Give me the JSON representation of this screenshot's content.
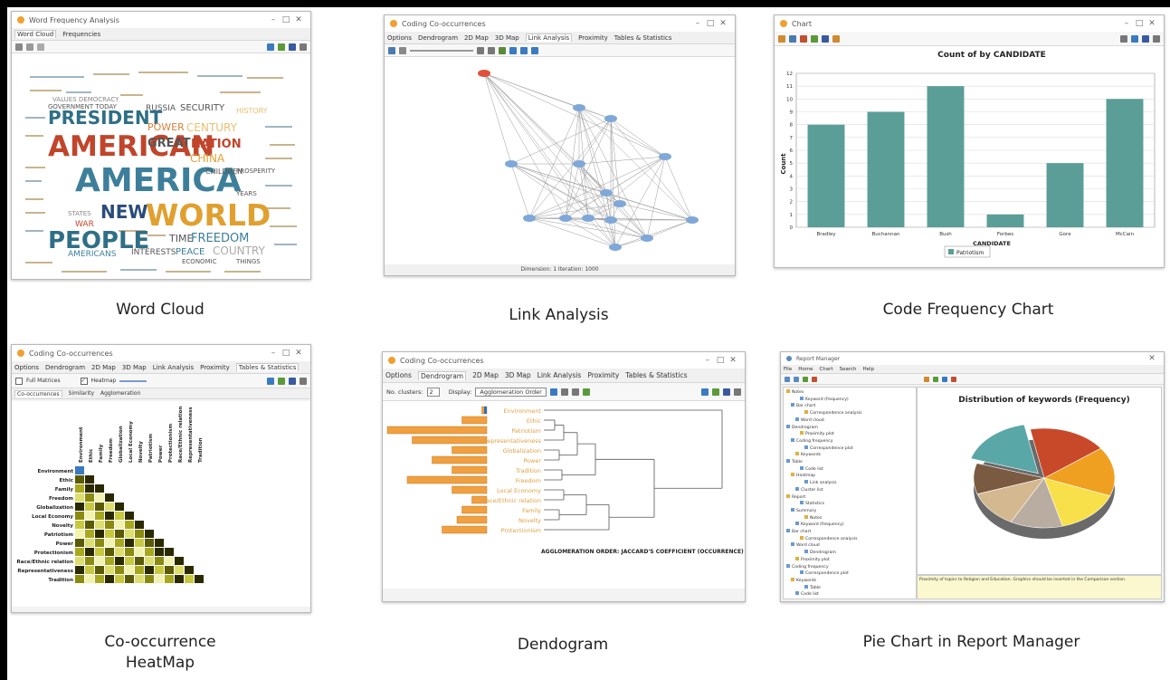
{
  "captions": {
    "word_cloud": "Word Cloud",
    "link_analysis": "Link Analysis",
    "code_frequency": "Code Frequency Chart",
    "heatmap_line1": "Co-occurrence",
    "heatmap_line2": "HeatMap",
    "dendogram": "Dendogram",
    "pie_report": "Pie Chart in Report Manager"
  },
  "word_cloud_win": {
    "tabs": [
      "Word Cloud",
      "Frequencies"
    ],
    "words_big": [
      "AMERICAN",
      "AMERICA",
      "WORLD",
      "PEOPLE",
      "PRESIDENT",
      "NEW"
    ],
    "words_mid": [
      "NATION",
      "GREAT",
      "POWER",
      "CENTURY",
      "FREEDOM",
      "COUNTRY",
      "CHINA",
      "TIME",
      "PEACE",
      "INTERESTS",
      "AMERICANS",
      "SECURITY",
      "RUSSIA",
      "GOVERNMENT TODAY",
      "VALUES DEMOCRACY",
      "WAR",
      "STATES",
      "CHILDREN",
      "HISTORY",
      "PROSPERITY",
      "YEARS",
      "ECONOMIC",
      "THINGS"
    ]
  },
  "link_win": {
    "title": "Coding Co-occurrences",
    "menu": [
      "Options",
      "Dendrogram",
      "2D Map",
      "3D Map",
      "Link Analysis",
      "Proximity",
      "Tables & Statistics"
    ],
    "status": "Dimension: 1    Iteration: 1000"
  },
  "bar_win": {
    "title": "Chart",
    "accent": "#5a9e97"
  },
  "chart_data": {
    "type": "bar",
    "title": "Count of by CANDIDATE",
    "xlabel": "CANDIDATE",
    "ylabel": "Count",
    "categories": [
      "Bradley",
      "Buchannan",
      "Bush",
      "Forbes",
      "Gore",
      "McCain"
    ],
    "series": [
      {
        "name": "Patriotism",
        "values": [
          8,
          9,
          11,
          1,
          5,
          10
        ]
      }
    ],
    "ylim": [
      0,
      12
    ],
    "yticks": [
      0,
      1,
      2,
      3,
      4,
      5,
      6,
      7,
      8,
      9,
      10,
      11,
      12
    ],
    "grid": true,
    "legend": "bottom"
  },
  "heat_win": {
    "title": "Coding Co-occurrences",
    "menu": [
      "Options",
      "Dendrogram",
      "2D Map",
      "3D Map",
      "Link Analysis",
      "Proximity",
      "Tables & Statistics"
    ],
    "checkbox_full": "Full Matrices",
    "checkbox_heat": "Heatmap",
    "subtabs": [
      "Co-occurrences",
      "Similarity",
      "Agglomeration"
    ],
    "labels": [
      "Environment",
      "Ethic",
      "Family",
      "Freedom",
      "Globalization",
      "Local Economy",
      "Novelty",
      "Patriotism",
      "Power",
      "Protectionism",
      "Race/Ethnic relation",
      "Representativeness",
      "Tradition"
    ]
  },
  "dendo_win": {
    "title": "Coding Co-occurrences",
    "menu": [
      "Options",
      "Dendrogram",
      "2D Map",
      "3D Map",
      "Link Analysis",
      "Proximity",
      "Tables & Statistics"
    ],
    "clusters_label": "No. clusters:",
    "clusters_value": "2",
    "display_label": "Display:",
    "display_value": "Agglomeration Order",
    "labels": [
      "Environment",
      "Ethic",
      "Patriotism",
      "Representativeness",
      "Globalization",
      "Power",
      "Tradition",
      "Freedom",
      "Local Economy",
      "Race/Ethnic relation",
      "Family",
      "Novelty",
      "Protectionism"
    ],
    "bars": [
      0.05,
      0.25,
      1.0,
      0.75,
      0.35,
      0.55,
      0.35,
      0.8,
      0.35,
      0.15,
      0.25,
      0.3,
      0.45
    ],
    "footer": "AGGLOMERATION ORDER: JACCARD'S COEFFICIENT (OCCURRENCE)",
    "bar_color": "#f0a040"
  },
  "report_win": {
    "title": "Report Manager",
    "menu": [
      "File",
      "Home",
      "Chart",
      "Search",
      "Help"
    ],
    "pie_title": "Distribution of keywords (Frequency)",
    "pie_colors": [
      "#c8492a",
      "#f0a020",
      "#f7e04a",
      "#b9aca0",
      "#d4b890",
      "#7a5a40",
      "#5aa7a7"
    ],
    "pie_values": [
      18.0,
      16.0,
      15.0,
      12.0,
      12.0,
      10.0,
      17.0
    ],
    "tree_items": [
      "Notes",
      "Keyword (frequency)",
      "Bar chart",
      "Correspondence analysis",
      "Word cloud",
      "Dendrogram",
      "Proximity plot",
      "Coding frequency",
      "Correspondence plot",
      "Keywords",
      "Table",
      "Code list",
      "Heatmap",
      "Link analysis",
      "Cluster list",
      "Report",
      "Statistics",
      "Summary"
    ],
    "footer_note": "Proximity of topics to Religion and Education. Graphics should be inserted in the Comparison section."
  }
}
